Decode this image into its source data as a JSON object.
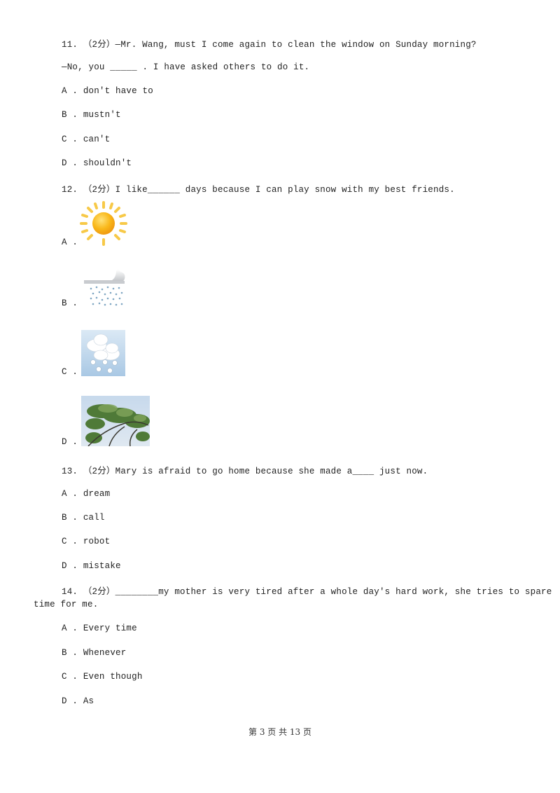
{
  "questions": [
    {
      "number": "11.",
      "score": "（2分）",
      "stem": "—Mr. Wang, must I come again to clean the window on Sunday morning?",
      "stem2": "—No, you _____ . I have asked others to do it.",
      "options": [
        {
          "label": "A .",
          "text": "don't have to"
        },
        {
          "label": "B .",
          "text": "mustn't"
        },
        {
          "label": "C .",
          "text": "can't"
        },
        {
          "label": "D .",
          "text": "shouldn't"
        }
      ]
    },
    {
      "number": "12.",
      "score": "（2分）",
      "stem": "I like______ days because I can play snow with my best friends.",
      "options": [
        {
          "label": "A .",
          "image": "sunny-weather-icon"
        },
        {
          "label": "B .",
          "image": "rainy-weather-icon"
        },
        {
          "label": "C .",
          "image": "snowy-weather-icon"
        },
        {
          "label": "D .",
          "image": "windy-tree-photo"
        }
      ]
    },
    {
      "number": "13.",
      "score": "（2分）",
      "stem": "Mary is afraid to go home because she made a____ just now.",
      "options": [
        {
          "label": "A .",
          "text": "dream"
        },
        {
          "label": "B .",
          "text": "call"
        },
        {
          "label": "C .",
          "text": "robot"
        },
        {
          "label": "D .",
          "text": "mistake"
        }
      ]
    },
    {
      "number": "14.",
      "score": "（2分）",
      "stem": "________my mother is very tired after a whole day's hard work, she tries to spare",
      "stem2": "time for me.",
      "options": [
        {
          "label": "A .",
          "text": "Every time"
        },
        {
          "label": "B .",
          "text": "Whenever"
        },
        {
          "label": "C .",
          "text": "Even though"
        },
        {
          "label": "D .",
          "text": "As"
        }
      ]
    }
  ],
  "footer": {
    "text": "第 3 页 共 13 页"
  }
}
